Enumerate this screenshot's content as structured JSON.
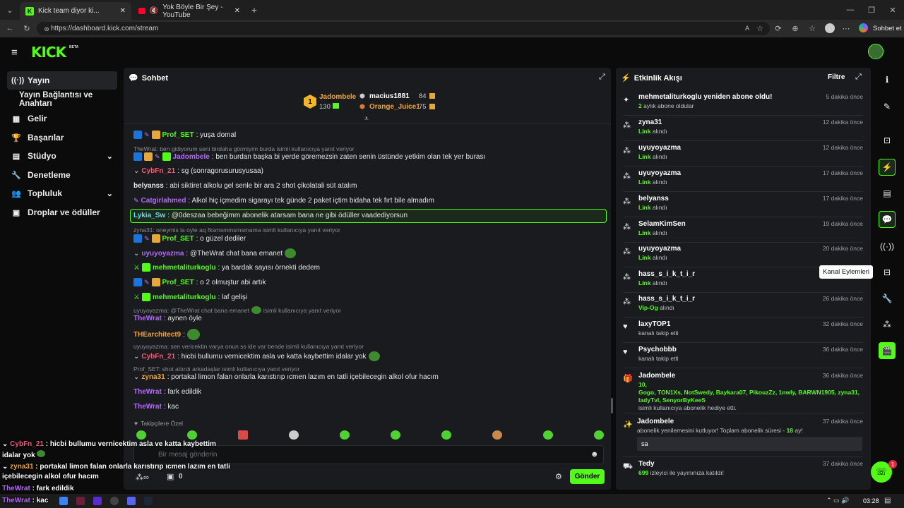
{
  "browser": {
    "tabs": [
      {
        "label": "Kick team diyor ki..."
      },
      {
        "label": "Yok Böyle Bir Şey - YouTube"
      }
    ],
    "url": "https://dashboard.kick.com/stream",
    "copilot": "Sohbet et"
  },
  "kick": {
    "logo": "KICK",
    "beta": "BETA"
  },
  "sidebar": {
    "items": [
      {
        "label": "Yayın",
        "icon": "broadcast-icon"
      },
      {
        "label": "Yayın Bağlantısı ve Anahtarı"
      },
      {
        "label": "Gelir",
        "icon": "chart-icon"
      },
      {
        "label": "Başarılar",
        "icon": "trophy-icon"
      },
      {
        "label": "Stüdyo",
        "icon": "studio-icon"
      },
      {
        "label": "Denetleme",
        "icon": "wrench-icon"
      },
      {
        "label": "Topluluk",
        "icon": "community-icon"
      },
      {
        "label": "Droplar ve ödüller",
        "icon": "drops-icon"
      }
    ]
  },
  "chat": {
    "title": "Sohbet",
    "leaderboard": {
      "first": {
        "rank": "1",
        "name": "Jadombele",
        "count": "130"
      },
      "others": [
        {
          "name": "macius1881",
          "count": "84"
        },
        {
          "name": "Orange_Juice1",
          "count": "75"
        }
      ]
    },
    "messages": [
      {
        "user": "Prof_SET",
        "text": ": yuşa domal"
      },
      {
        "reply": "TheWrat: ben gidiyorum seni birdaha görmiyim burda isimli kullanıcıya yanıt veriyor"
      },
      {
        "user": "Jadombele",
        "text": ": ben burdan başka bi yerde göremezsin zaten senin üstünde yetkim olan tek yer burası"
      },
      {
        "user": "CybFn_21",
        "text": ": sg (sonragorusurusyusaa)"
      },
      {
        "user": "belyanss",
        "text": ": abi siktiret alkolu gel senle bir ara 2 shot çikolatali süt atalım"
      },
      {
        "user": "Catgirlahmed",
        "text": ": Alkol hiç içmedim sigarayı tek günde 2 paket içtim bidaha tek fırt bile almadım"
      },
      {
        "user": "Lykia_Sw",
        "text": ": @0deszaa bebeğimm abonelik atarsam bana ne gibi ödüller vaadediyorsun"
      },
      {
        "reply": "zyna31: oneymis la oyle aq fksmsmmsmsmama isimli kullanıcıya yanıt veriyor"
      },
      {
        "user": "Prof_SET",
        "text": ": o güzel dediler"
      },
      {
        "user": "uyuyoyazma",
        "text": ": @TheWrat chat bana emanet"
      },
      {
        "user": "mehmetaliturkoglu",
        "text": ": ya bardak sayısı örnekti dedem"
      },
      {
        "user": "Prof_SET",
        "text": ": o 2 olmuştur abi artık"
      },
      {
        "user": "mehmetaliturkoglu",
        "text": ": laf gelişi"
      },
      {
        "reply": "uyuyoyazma: @TheWrat chat bana emanet",
        "reply2": "isimli kullanıcıya yanıt veriyor"
      },
      {
        "user": "TheWrat",
        "text": ": aynen öyle"
      },
      {
        "user": "THEarchitect9",
        "text": ":"
      },
      {
        "reply": "uyuyoyazma: sen vericektin varya onun ss ide var bende isimli kullanıcıya yanıt veriyor"
      },
      {
        "user": "CybFn_21",
        "text": ": hicbi bullumu vernicektim asla ve katta kaybettim idalar yok"
      },
      {
        "reply": "Prof_SET: shot attırdı arkadaşlar isimli kullanıcıya yanıt veriyor"
      },
      {
        "user": "zyna31",
        "text": ": portakal limon falan onlarla karıstırıp ıcmen lazım en tatli içebilecegin alkol ofur hacım"
      },
      {
        "user": "TheWrat",
        "text": ": fark edildik"
      },
      {
        "user": "TheWrat",
        "text": ": kac"
      }
    ],
    "followers_label": "Takipçilere Özel",
    "input_placeholder": "Bir mesaj gönderin",
    "points": "0",
    "send_label": "Gönder"
  },
  "activity": {
    "title": "Etkinlik Akışı",
    "filter": "Filtre",
    "events": [
      {
        "name": "mehmetaliturkoglu yeniden abone oldu!",
        "hl": "2",
        "sub": " aylık abone oldular",
        "time": "5 dakika önce",
        "icon": "sparkle-icon"
      },
      {
        "name": "zyna31",
        "hl": "Link",
        "sub": " alındı",
        "time": "12 dakika önce",
        "icon": "drop-icon"
      },
      {
        "name": "uyuyoyazma",
        "hl": "Link",
        "sub": " alındı",
        "time": "12 dakika önce",
        "icon": "drop-icon"
      },
      {
        "name": "uyuyoyazma",
        "hl": "Link",
        "sub": " alındı",
        "time": "17 dakika önce",
        "icon": "drop-icon"
      },
      {
        "name": "belyanss",
        "hl": "Link",
        "sub": " alındı",
        "time": "17 dakika önce",
        "icon": "drop-icon"
      },
      {
        "name": "SelamKimSen",
        "hl": "Link",
        "sub": " alındı",
        "time": "19 dakika önce",
        "icon": "drop-icon"
      },
      {
        "name": "uyuyoyazma",
        "hl": "Link",
        "sub": " alındı",
        "time": "20 dakika önce",
        "icon": "drop-icon"
      },
      {
        "name": "hass_s_i_k_t_i_r",
        "hl": "Link",
        "sub": " alındı",
        "time": "",
        "icon": "drop-icon"
      },
      {
        "name": "hass_s_i_k_t_i_r",
        "hl": "Vip-Og",
        "sub": " alındı",
        "time": "26 dakika önce",
        "icon": "drop-icon"
      },
      {
        "name": "laxyTOP1",
        "hl": "",
        "sub": "kanalı takip etti",
        "time": "32 dakika önce",
        "icon": "heart-icon"
      },
      {
        "name": "Psychobbb",
        "hl": "",
        "sub": "kanalı takip etti",
        "time": "36 dakika önce",
        "icon": "heart-icon"
      }
    ],
    "gift": {
      "name": "Jadombele",
      "time": "36 dakika önce",
      "count": "10,",
      "gifted": "Gogo, TON1Xs, NotSwedy, Baykara07, PikouzZz, 1nwly, BARWN1905, zyna31, ladyTvl, SenyorByKeeS",
      "sub": "isimli kullanıcıya abonelik hediye etti."
    },
    "renew": {
      "name": "Jadombele",
      "time": "37 dakika önce",
      "sub": "abonelik yenilemesini kutluyor! Toplam abonelik süresi - ",
      "months": "18",
      "unit": " ay!",
      "message": "sa"
    },
    "raid": {
      "name": "Tedy",
      "time": "37 dakika önce",
      "viewers": "699",
      "sub": " izleyici ile yayınınıza katıldı!"
    }
  },
  "rail": {
    "tooltip": "Kanal Eylemleri",
    "notif": "1"
  },
  "overlay": [
    {
      "user": "CybFn_21",
      "text": " : hicbi bullumu vernicektim asla ve katta kaybettim"
    },
    {
      "user": "",
      "text": "idalar yok"
    },
    {
      "user": "zyna31",
      "text": " : portakal limon falan onlarla karıstırıp ıcmen lazım en tatli"
    },
    {
      "user": "",
      "text": "içebilecegin alkol ofur hacım"
    },
    {
      "user": "TheWrat",
      "text": " : fark edildik"
    },
    {
      "user": "TheWrat",
      "text": " : kac"
    }
  ],
  "taskbar": {
    "time": "03:28"
  },
  "colors": {
    "accent": "#53fc18",
    "purple": "#b36bf5",
    "pink": "#f05b78",
    "orange": "#f2a43a",
    "cyan": "#5be0f5"
  }
}
